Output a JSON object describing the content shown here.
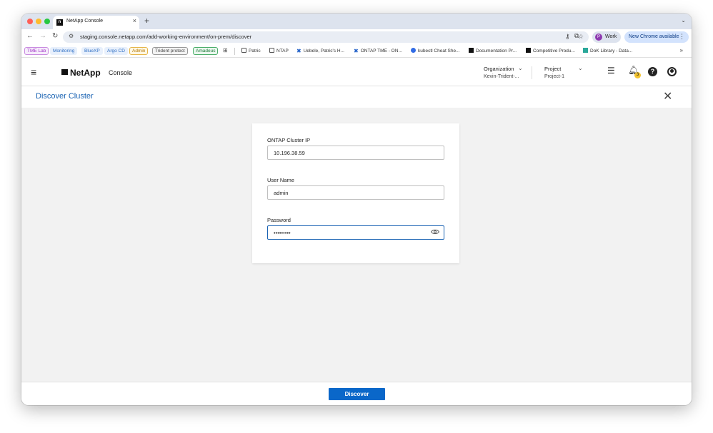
{
  "browser": {
    "tab_title": "NetApp Console",
    "tab_favicon": "n",
    "tab_close": "×",
    "new_tab": "+",
    "tab_search": "⌄",
    "url": "staging.console.netapp.com/add-working-environment/on-prem/discover",
    "profile_initial": "P",
    "profile_label": "Work",
    "update_label": "New Chrome available",
    "menu_glyph": "⋮"
  },
  "bookmarks": {
    "tags": [
      {
        "label": "TME Lab",
        "color": "#a033c7"
      },
      {
        "label": "Monitoring",
        "color": "#3b7dd8"
      },
      {
        "label": "BlueXP",
        "color": "#3b7dd8"
      },
      {
        "label": "Argo CD",
        "color": "#3b7dd8"
      },
      {
        "label": "Admin",
        "color": "#e0a020"
      },
      {
        "label": "Trident protect",
        "color": "#666666"
      },
      {
        "label": "Amadeus",
        "color": "#2e9e4f"
      }
    ],
    "links": [
      "Patric",
      "NTAP",
      "Uebele, Patric's H...",
      "ONTAP TME - ON...",
      "kubectl Cheat She...",
      "Documentation Pr...",
      "Competitive Produ...",
      "DoK Library - Data..."
    ],
    "more_glyph": "»"
  },
  "header": {
    "logo_text": "NetApp",
    "console_label": "Console",
    "organization_label": "Organization",
    "organization_value": "Kevin-Trident-...",
    "project_label": "Project",
    "project_value": "Project-1",
    "notification_count": "3",
    "help_glyph": "?"
  },
  "page": {
    "title": "Discover Cluster",
    "close_glyph": "✕"
  },
  "form": {
    "ip_label": "ONTAP Cluster IP",
    "ip_value": "10.196.38.59",
    "user_label": "User Name",
    "user_value": "admin",
    "password_label": "Password",
    "password_value": "•••••••••"
  },
  "footer": {
    "discover_label": "Discover"
  },
  "colors": {
    "accent": "#0a67c9",
    "title_blue": "#1a63b3"
  }
}
